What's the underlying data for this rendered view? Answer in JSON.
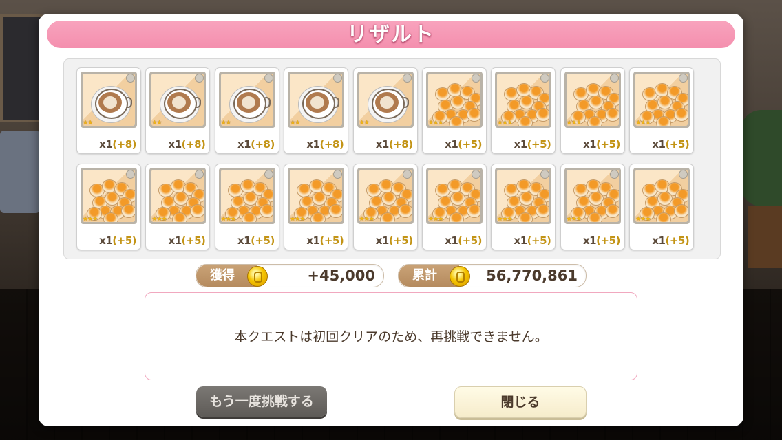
{
  "dialog": {
    "title": "リザルト",
    "message": "本クエストは初回クリアのため、再挑戦できません。",
    "buttons": {
      "retry_label": "もう一度挑戦する",
      "close_label": "閉じる"
    }
  },
  "rewards": {
    "row1": [
      {
        "type": "latte",
        "stars": "★★",
        "qty": "x1",
        "bonus": "(+8)"
      },
      {
        "type": "latte",
        "stars": "★★",
        "qty": "x1",
        "bonus": "(+8)"
      },
      {
        "type": "latte",
        "stars": "★★",
        "qty": "x1",
        "bonus": "(+8)"
      },
      {
        "type": "latte",
        "stars": "★★",
        "qty": "x1",
        "bonus": "(+8)"
      },
      {
        "type": "latte",
        "stars": "★★",
        "qty": "x1",
        "bonus": "(+8)"
      },
      {
        "type": "buns",
        "stars": "★★★",
        "qty": "x1",
        "bonus": "(+5)"
      },
      {
        "type": "buns",
        "stars": "★★★",
        "qty": "x1",
        "bonus": "(+5)"
      },
      {
        "type": "buns",
        "stars": "★★★",
        "qty": "x1",
        "bonus": "(+5)"
      },
      {
        "type": "buns",
        "stars": "★★★",
        "qty": "x1",
        "bonus": "(+5)"
      }
    ],
    "row2": [
      {
        "type": "buns",
        "stars": "★★★",
        "qty": "x1",
        "bonus": "(+5)"
      },
      {
        "type": "buns",
        "stars": "★★★",
        "qty": "x1",
        "bonus": "(+5)"
      },
      {
        "type": "buns",
        "stars": "★★★",
        "qty": "x1",
        "bonus": "(+5)"
      },
      {
        "type": "buns",
        "stars": "★★★",
        "qty": "x1",
        "bonus": "(+5)"
      },
      {
        "type": "buns",
        "stars": "★★★",
        "qty": "x1",
        "bonus": "(+5)"
      },
      {
        "type": "buns",
        "stars": "★★★",
        "qty": "x1",
        "bonus": "(+5)"
      },
      {
        "type": "buns",
        "stars": "★★★",
        "qty": "x1",
        "bonus": "(+5)"
      },
      {
        "type": "buns",
        "stars": "★★★",
        "qty": "x1",
        "bonus": "(+5)"
      },
      {
        "type": "buns",
        "stars": "★★★",
        "qty": "x1",
        "bonus": "(+5)"
      }
    ],
    "scroll_position": 0.6
  },
  "currency": {
    "gained_label": "獲得",
    "gained_value": "+45,000",
    "total_label": "累計",
    "total_value": "56,770,861",
    "coin_icon": "gold-coin-icon"
  },
  "colors": {
    "title_pink": "#f48fae",
    "pill_brown": "#b58b5f",
    "bonus_gold": "#c39416",
    "text_brown": "#4b3a2c"
  }
}
